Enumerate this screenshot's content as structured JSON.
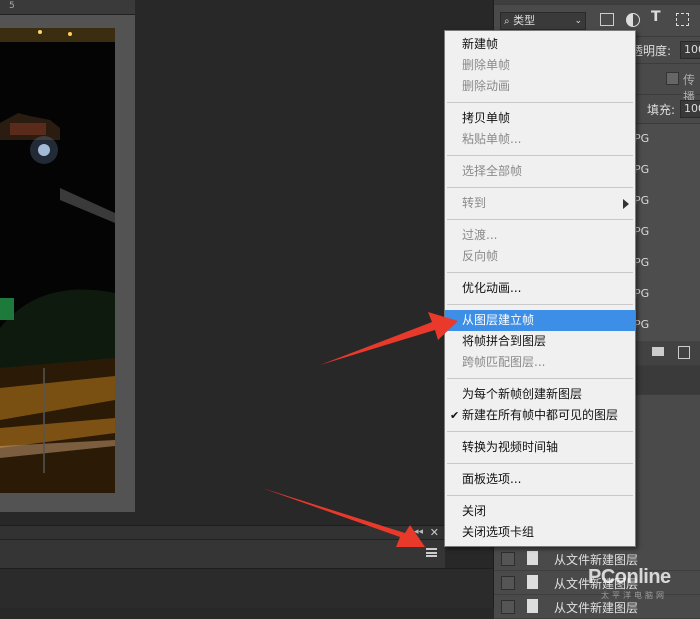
{
  "ruler": {
    "tick": "5"
  },
  "layers_panel": {
    "filter_kind": "类型",
    "opacity_label": "透明度:",
    "opacity_value": "100",
    "propagate_label": "传播",
    "fill_label": "填充:",
    "fill_value": "100",
    "layer_suffix": "PG",
    "bottom_layers": [
      "从文件新建图层",
      "从文件新建图层",
      "从文件新建图层"
    ]
  },
  "context_menu": {
    "items": [
      {
        "label": "新建帧",
        "enabled": true
      },
      {
        "label": "删除单帧",
        "enabled": false
      },
      {
        "label": "删除动画",
        "enabled": false
      },
      {
        "label": "拷贝单帧",
        "enabled": true
      },
      {
        "label": "粘贴单帧...",
        "enabled": false
      },
      {
        "label": "选择全部帧",
        "enabled": false
      },
      {
        "label": "转到",
        "enabled": false,
        "submenu": true
      },
      {
        "label": "过渡...",
        "enabled": false
      },
      {
        "label": "反向帧",
        "enabled": false
      },
      {
        "label": "优化动画...",
        "enabled": true
      },
      {
        "label": "从图层建立帧",
        "enabled": true,
        "highlighted": true
      },
      {
        "label": "将帧拼合到图层",
        "enabled": true
      },
      {
        "label": "跨帧匹配图层...",
        "enabled": false
      },
      {
        "label": "为每个新帧创建新图层",
        "enabled": true
      },
      {
        "label": "新建在所有帧中都可见的图层",
        "enabled": true,
        "checked": true
      },
      {
        "label": "转换为视频时间轴",
        "enabled": true
      },
      {
        "label": "面板选项...",
        "enabled": true
      },
      {
        "label": "关闭",
        "enabled": true
      },
      {
        "label": "关闭选项卡组",
        "enabled": true
      }
    ]
  },
  "watermark": {
    "text": "PConline",
    "sub": "太平洋电脑网"
  },
  "colors": {
    "accent": "#3d8ee6",
    "arrow": "#e8392b",
    "menu_bg": "#f0f0f0"
  }
}
